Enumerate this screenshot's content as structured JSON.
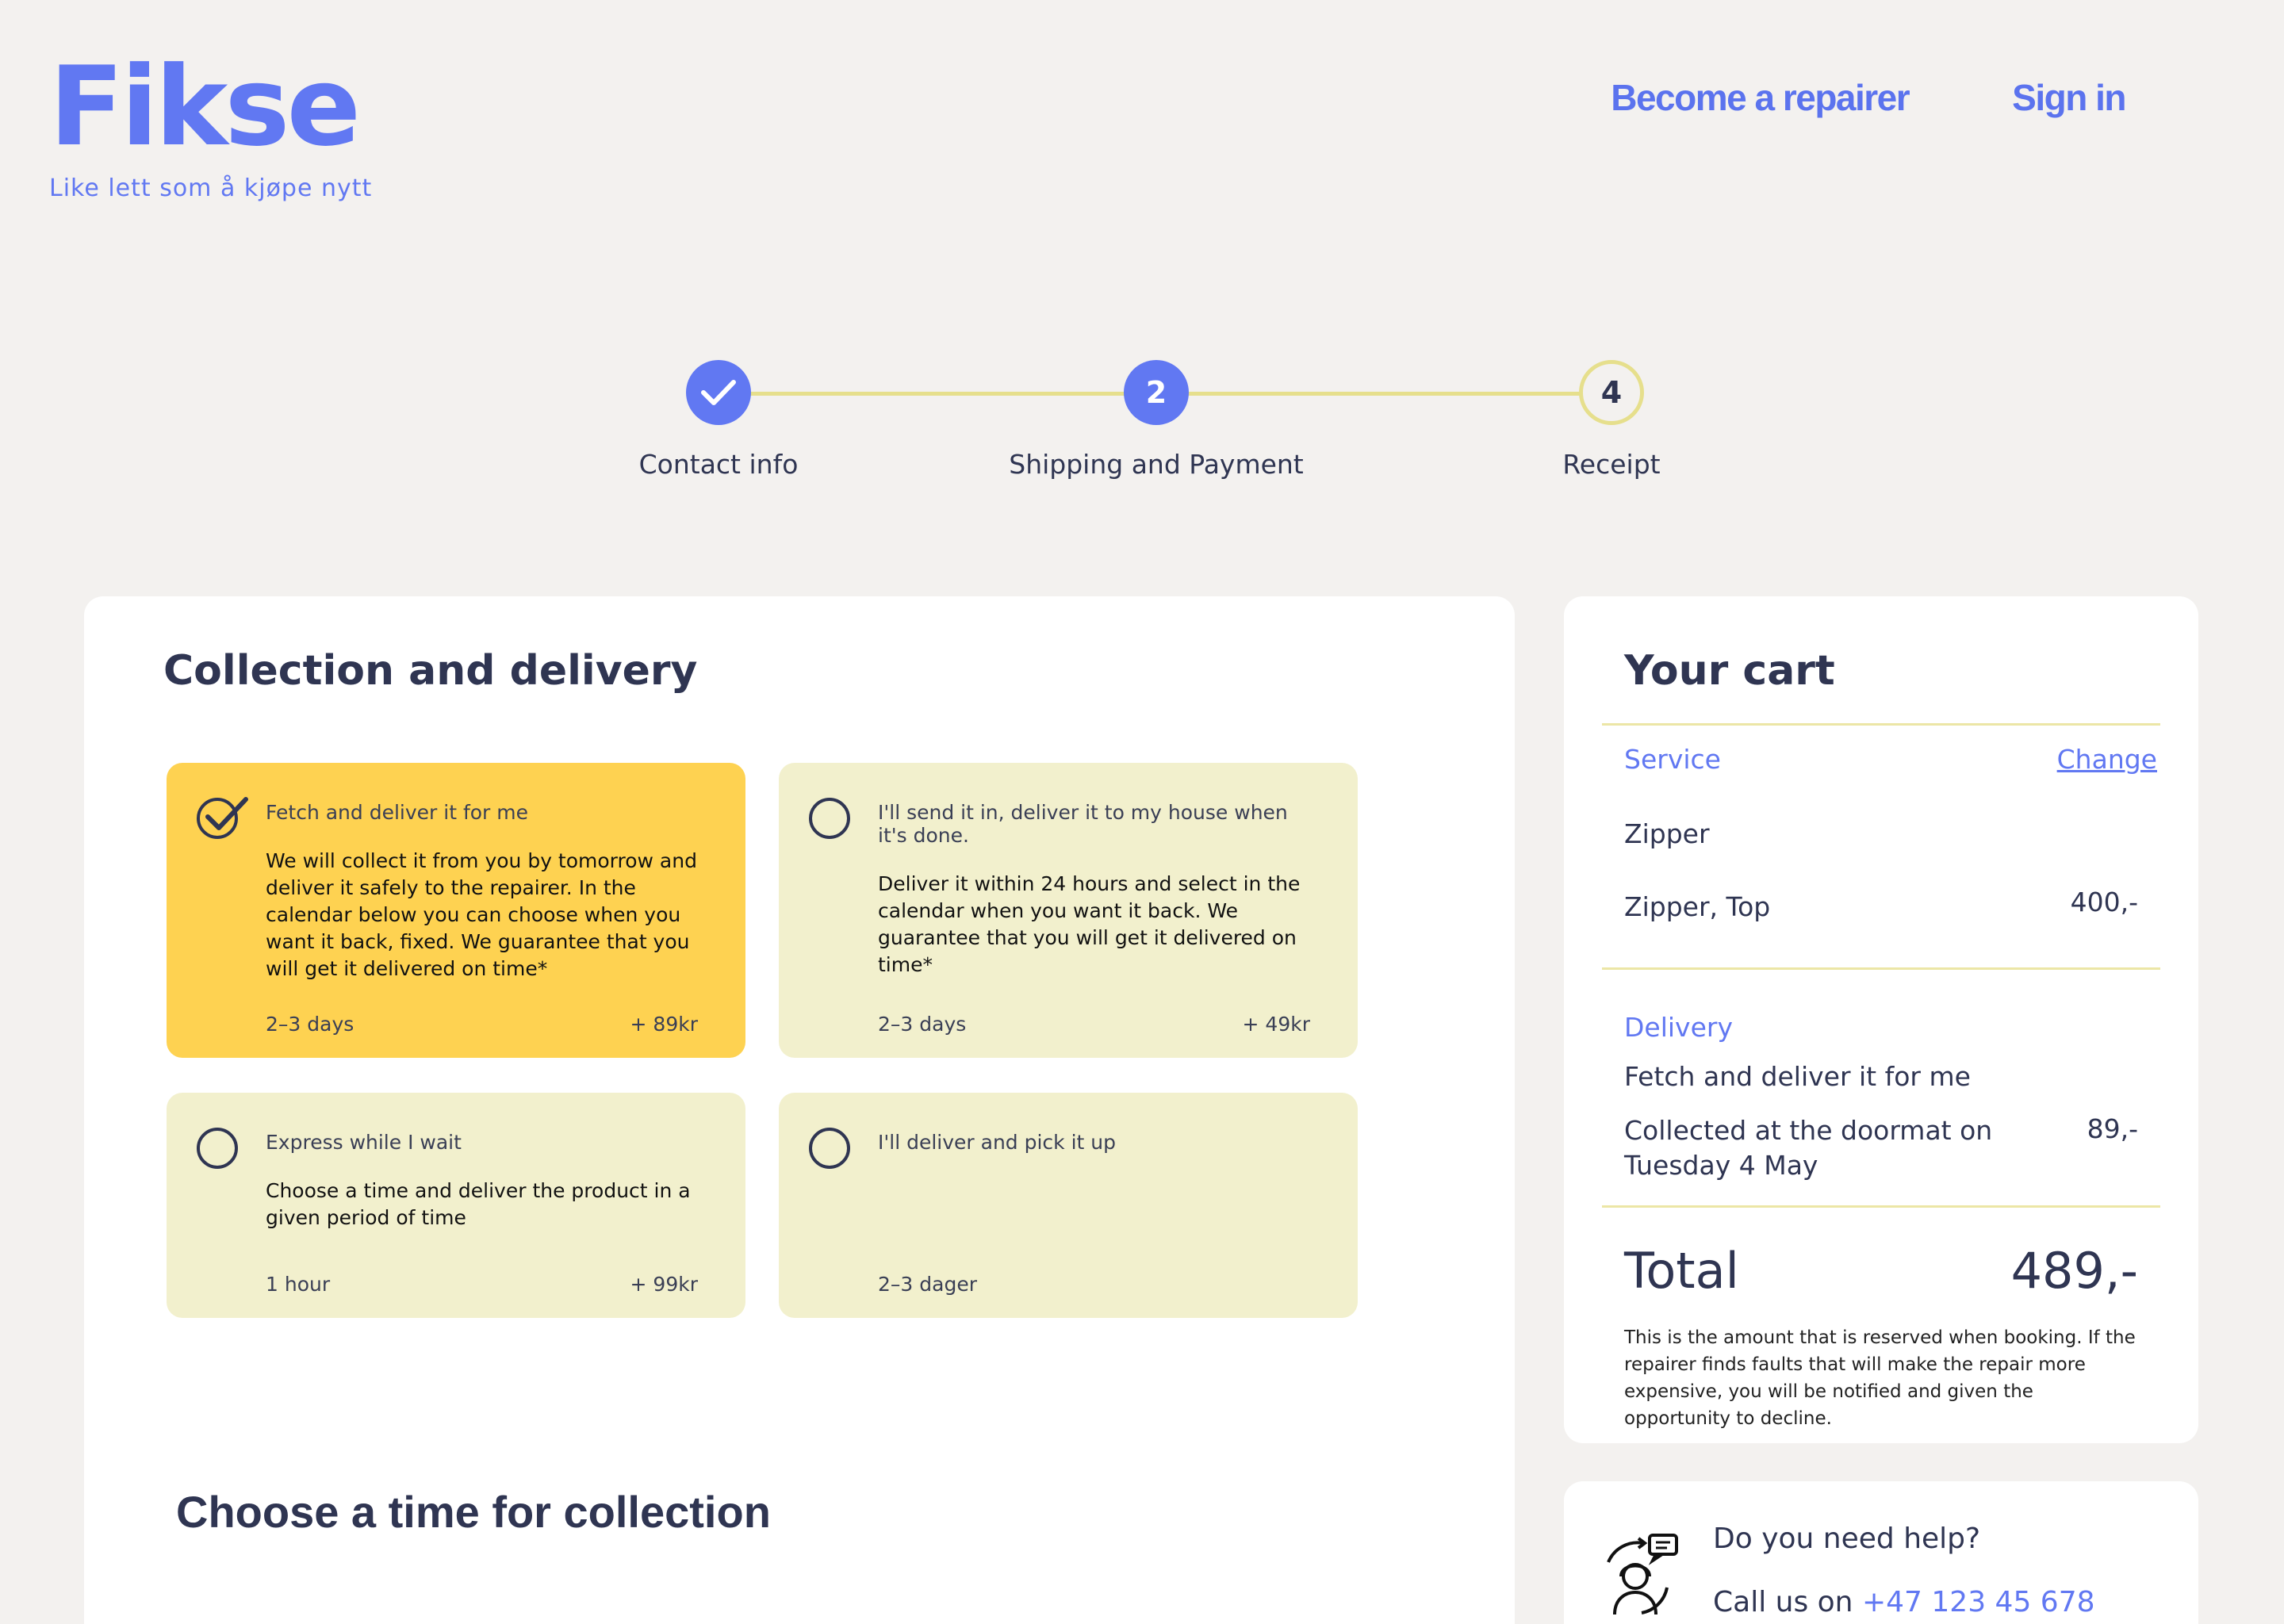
{
  "brand": {
    "logo": "Fikse",
    "tagline": "Like lett som å kjøpe nytt"
  },
  "nav": {
    "become_repairer": "Become a repairer",
    "sign_in": "Sign in"
  },
  "stepper": {
    "steps": [
      {
        "label": "Contact info",
        "number": "",
        "state": "done"
      },
      {
        "label": "Shipping and Payment",
        "number": "2",
        "state": "active"
      },
      {
        "label": "Receipt",
        "number": "4",
        "state": "pending"
      }
    ]
  },
  "collection": {
    "title": "Collection and delivery",
    "options": [
      {
        "title": "Fetch and deliver it for me",
        "description": "We will collect it from you by tomorrow and deliver it safely to the repairer. In the calendar below you can choose when you want it back, fixed. We guarantee that you will get it delivered on time*",
        "duration": "2–3 days",
        "price": "+ 89kr",
        "selected": true
      },
      {
        "title": "I'll send it in, deliver it to my house when it's done.",
        "description": "Deliver it within 24 hours and select in the calendar when you want it back. We guarantee that you will get it delivered on time*",
        "duration": "2–3 days",
        "price": "+ 49kr",
        "selected": false
      },
      {
        "title": "Express while I wait",
        "description": "Choose a time and deliver the product in a given period of time",
        "duration": "1  hour",
        "price": "+ 99kr",
        "selected": false
      },
      {
        "title": "I'll deliver and pick it up",
        "description": "",
        "duration": "2–3 dager",
        "price": "",
        "selected": false
      }
    ],
    "time_title": "Choose a time for collection"
  },
  "cart": {
    "title": "Your cart",
    "service_label": "Service",
    "change_link": "Change",
    "service_name": "Zipper",
    "service_item": "Zipper, Top",
    "service_price": "400,-",
    "delivery_label": "Delivery",
    "delivery_method": "Fetch and deliver it for me",
    "delivery_detail_1": "Collected at the doormat on",
    "delivery_detail_2": "Tuesday 4 May",
    "delivery_price": "89,-",
    "total_label": "Total",
    "total_value": "489,-",
    "note": "This is the amount that is reserved when booking. If the repairer finds faults that will make the repair more expensive, you will be notified and given the opportunity to decline."
  },
  "help": {
    "title": "Do you need help?",
    "call_prefix": "Call us on",
    "phone": "+47 123 45 678"
  },
  "colors": {
    "accent": "#6178f2",
    "selected_option": "#fed251",
    "option_bg": "#f2f0cd",
    "stepper_line": "#e6df8c",
    "page_bg": "#f3f1ef"
  }
}
